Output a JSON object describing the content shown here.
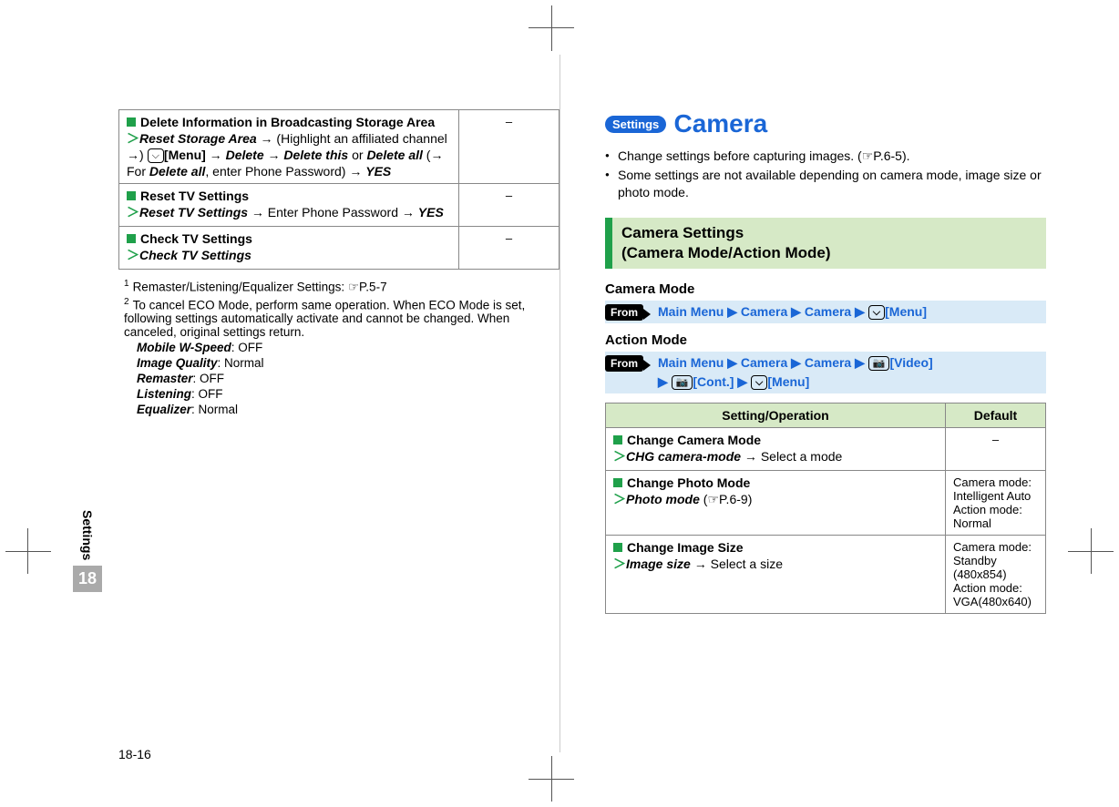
{
  "sideTab": {
    "label": "Settings",
    "number": "18"
  },
  "pageNumber": "18-16",
  "left": {
    "rows": [
      {
        "title": "Delete Information in Broadcasting Storage Area",
        "op_cmd": "Reset Storage Area",
        "op_after1": " → (Highlight an affiliated channel →) ",
        "op_key": "[Menu]",
        "op_after2": " → ",
        "op_delete": "Delete",
        "op_after3": " → ",
        "op_deletethis": "Delete this",
        "op_or": " or ",
        "op_deleteall": "Delete all",
        "op_paren1": " (→ For ",
        "op_deleteall2": "Delete all",
        "op_paren2": ", enter Phone Password) → ",
        "op_yes": "YES",
        "default": "–"
      },
      {
        "title": "Reset TV Settings",
        "op_cmd": "Reset TV Settings",
        "op_tail": " → Enter Phone Password → ",
        "op_yes": "YES",
        "default": "–"
      },
      {
        "title": "Check TV Settings",
        "op_cmd": "Check TV Settings",
        "default": "–"
      }
    ],
    "footnotes": {
      "f1": "Remaster/Listening/Equalizer Settings: ",
      "f1_ref": "P.5-7",
      "f2a": "To cancel ECO Mode, perform same operation. When ECO Mode is set, following settings automatically activate and cannot be changed. When canceled, original settings return.",
      "mwspeed_l": "Mobile W-Speed",
      "mwspeed_v": ": OFF",
      "imgq_l": "Image Quality",
      "imgq_v": ": Normal",
      "remaster_l": "Remaster",
      "remaster_v": ": OFF",
      "listening_l": "Listening",
      "listening_v": ": OFF",
      "eq_l": "Equalizer",
      "eq_v": ": Normal"
    }
  },
  "right": {
    "badge": "Settings",
    "title": "Camera",
    "bullets": [
      {
        "text": "Change settings before capturing images. (",
        "ref": "P.6-5",
        "tail": ")."
      },
      {
        "text": "Some settings are not available depending on camera mode, image size or photo mode."
      }
    ],
    "sectionBar1": "Camera Settings",
    "sectionBar2": "(Camera Mode/Action Mode)",
    "cameraModeLabel": "Camera Mode",
    "actionModeLabel": "Action Mode",
    "fromLabel": "From",
    "nav1": {
      "p1": "Main Menu",
      "p2": "Camera",
      "p3": "Camera",
      "menu": "[Menu]"
    },
    "nav2": {
      "p1": "Main Menu",
      "p2": "Camera",
      "p3": "Camera",
      "video": "[Video]",
      "cont": "[Cont.]",
      "menu": "[Menu]"
    },
    "tableHeaders": {
      "setting": "Setting/Operation",
      "default": "Default"
    },
    "rows": [
      {
        "title": "Change Camera Mode",
        "cmd": "CHG camera-mode",
        "tail": " → Select a mode",
        "default": "–",
        "defAlign": "center"
      },
      {
        "title": "Change Photo Mode",
        "cmd": "Photo mode",
        "tail": " (",
        "ref": "P.6-9",
        "tail2": ")",
        "default": "Camera mode: Intelligent Auto\nAction mode: Normal",
        "defAlign": "left"
      },
      {
        "title": "Change Image Size",
        "cmd": "Image size",
        "tail": " → Select a size",
        "default": "Camera mode: Standby (480x854)\nAction mode: VGA(480x640)",
        "defAlign": "left"
      }
    ]
  }
}
